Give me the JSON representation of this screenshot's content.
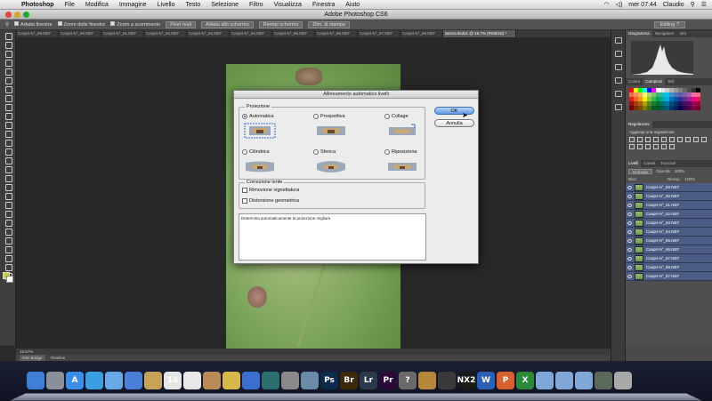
{
  "menubar": {
    "apple": "",
    "items": [
      "Photoshop",
      "File",
      "Modifica",
      "Immagine",
      "Livello",
      "Testo",
      "Selezione",
      "Filtro",
      "Visualizza",
      "Finestra",
      "Aiuto"
    ],
    "time": "mer 07:44",
    "user": "Claudio"
  },
  "window": {
    "title": "Adobe Photoshop CS6"
  },
  "options": {
    "c1": "Adatta finestre",
    "c2": "Zoom delle finestre",
    "c3": "Zoom a scorrimento",
    "b1": "Pixel reali",
    "b2": "Adatta allo schermo",
    "b3": "Riempi schermo",
    "b4": "Dim. di stampa",
    "workspace": "Editing ?"
  },
  "doc_tabs": [
    "Caspri-N°_59.NEF",
    "Caspri-N°_60.NEF",
    "Caspri-N°_61.NEF",
    "Caspri-N°_62.NEF",
    "Caspri-N°_63.NEF",
    "Caspri-N°_64.NEF",
    "Caspri-N°_65.NEF",
    "Caspri-N°_66.NEF",
    "Caspri-N°_67.NEF",
    "Caspri-N°_68.NEF",
    "Senza titolo1 @ 16,7% (RGB/16) *"
  ],
  "status": {
    "zoom": "16,67%"
  },
  "bottom_tabs": [
    "Mini Bridge",
    "Timeline"
  ],
  "panels": {
    "histo_tabs": [
      "Istogramma",
      "Navigatore",
      "Info"
    ],
    "color_tabs": [
      "Colore",
      "Campioni",
      "Stili"
    ],
    "adjust_title": "Regolazioni",
    "adjust_hint": "Aggiungi una regolazione",
    "layer_tabs": [
      "Livelli",
      "Canali",
      "Tracciati"
    ],
    "blend_mode": "Normale",
    "opacity_label": "Opacità:",
    "opacity_value": "100%",
    "lock_label": "Bloc:",
    "fill_label": "Riemp.:",
    "fill_value": "100%",
    "layers": [
      "Caspri-N°_59.NEF",
      "Caspri-N°_60.NEF",
      "Caspri-N°_61.NEF",
      "Caspri-N°_62.NEF",
      "Caspri-N°_63.NEF",
      "Caspri-N°_64.NEF",
      "Caspri-N°_65.NEF",
      "Caspri-N°_66.NEF",
      "Caspri-N°_67.NEF",
      "Caspri-N°_68.NEF",
      "Caspri-N°_57.NEF"
    ]
  },
  "dialog": {
    "title": "Allineamento automatico livelli",
    "projection_label": "Proiezione",
    "options": [
      "Automatica",
      "Prospettiva",
      "Collage",
      "Cilindrica",
      "Sferica",
      "Riposiziona"
    ],
    "selected": "Automatica",
    "lens_label": "Correzione lente",
    "vignette": "Rimozione vignettatura",
    "distortion": "Distorsione geometrica",
    "ok": "OK",
    "cancel": "Annulla",
    "description": "Determina automaticamente la proiezione migliore."
  },
  "dock": {
    "icons": [
      {
        "name": "finder-icon",
        "label": "",
        "color": "#3f7fd8"
      },
      {
        "name": "launchpad-icon",
        "label": "",
        "color": "#8a8f9c"
      },
      {
        "name": "app-store-icon",
        "label": "A",
        "color": "#3b8ee8"
      },
      {
        "name": "safari-icon",
        "label": "",
        "color": "#3a9ee0"
      },
      {
        "name": "mail-icon",
        "label": "",
        "color": "#6aa7e8"
      },
      {
        "name": "itunes-icon",
        "label": "",
        "color": "#4a7fd8"
      },
      {
        "name": "notes-icon",
        "label": "",
        "color": "#c9a25a"
      },
      {
        "name": "calendar-icon",
        "label": "14",
        "color": "#e6e6e6"
      },
      {
        "name": "reminders-icon",
        "label": "",
        "color": "#e8e8e8"
      },
      {
        "name": "contacts-icon",
        "label": "",
        "color": "#b98a56"
      },
      {
        "name": "system-icon",
        "label": "",
        "color": "#d8b84a"
      },
      {
        "name": "xcode-icon",
        "label": "",
        "color": "#3a6fd0"
      },
      {
        "name": "time-machine-icon",
        "label": "",
        "color": "#2d6f6f"
      },
      {
        "name": "image-capture-icon",
        "label": "",
        "color": "#8a8a8a"
      },
      {
        "name": "preview-icon",
        "label": "",
        "color": "#6a8aa8"
      },
      {
        "name": "photoshop-icon",
        "label": "Ps",
        "color": "#0c2a4a"
      },
      {
        "name": "bridge-icon",
        "label": "Br",
        "color": "#3a2a0a"
      },
      {
        "name": "lightroom-icon",
        "label": "Lr",
        "color": "#2a3a4a"
      },
      {
        "name": "premiere-icon",
        "label": "Pr",
        "color": "#2a0a3a"
      },
      {
        "name": "help-icon",
        "label": "?",
        "color": "#6a6a6a"
      },
      {
        "name": "photo-icon",
        "label": "",
        "color": "#b8883a"
      },
      {
        "name": "camera-icon",
        "label": "",
        "color": "#3a3a3a"
      },
      {
        "name": "nx2-icon",
        "label": "NX2",
        "color": "#1a1a1a"
      },
      {
        "name": "word-icon",
        "label": "W",
        "color": "#2b5fb8"
      },
      {
        "name": "powerpoint-icon",
        "label": "P",
        "color": "#d8602a"
      },
      {
        "name": "excel-icon",
        "label": "X",
        "color": "#2a8a3a"
      },
      {
        "name": "applications-folder-icon",
        "label": "",
        "color": "#7fa7d8"
      },
      {
        "name": "documents-folder-icon",
        "label": "",
        "color": "#7fa7d8"
      },
      {
        "name": "downloads-folder-icon",
        "label": "",
        "color": "#7fa7d8"
      },
      {
        "name": "stack-icon",
        "label": "",
        "color": "#5a6a5a"
      },
      {
        "name": "trash-icon",
        "label": "",
        "color": "#a8a8a8"
      }
    ]
  }
}
